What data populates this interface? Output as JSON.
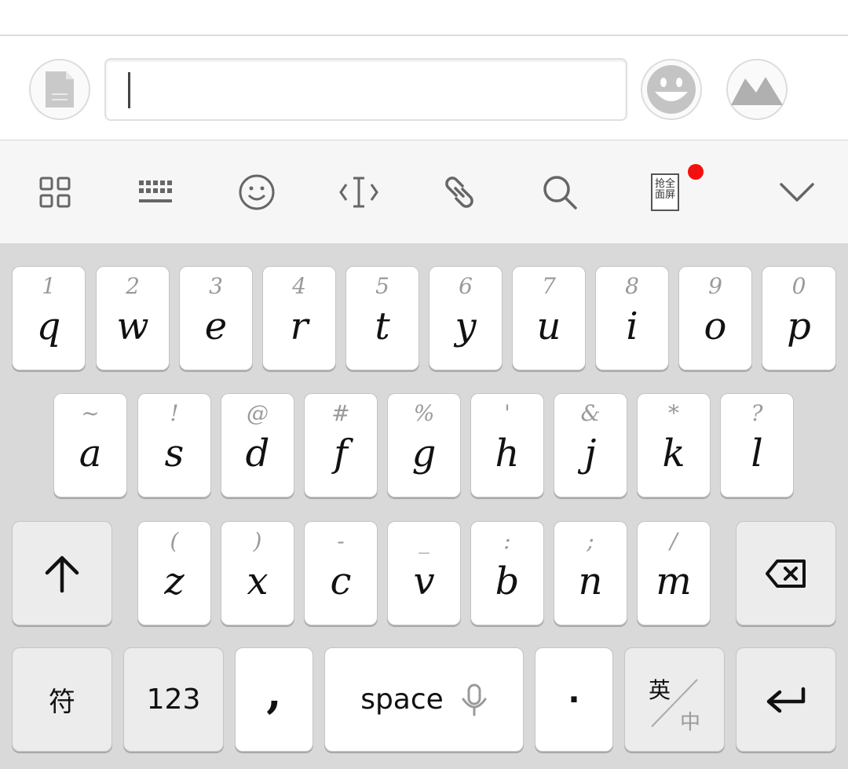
{
  "input_bar": {
    "file_icon": "file-icon",
    "emoji_icon": "emoji-face-icon",
    "image_icon": "mountain-image-icon",
    "text_value": ""
  },
  "toolbar": {
    "items": [
      {
        "icon": "grid-apps-icon"
      },
      {
        "icon": "keyboard-icon"
      },
      {
        "icon": "smiley-icon"
      },
      {
        "icon": "text-cursor-icon"
      },
      {
        "icon": "link-icon"
      },
      {
        "icon": "search-icon"
      },
      {
        "icon": "fullscreen-grab-icon",
        "label_line1": "抢全",
        "label_line2": "面屏"
      },
      {
        "icon": "chevron-down-icon"
      }
    ],
    "notification_color": "#f40f0f"
  },
  "keyboard": {
    "row1": [
      {
        "main": "q",
        "hint": "1"
      },
      {
        "main": "w",
        "hint": "2"
      },
      {
        "main": "e",
        "hint": "3"
      },
      {
        "main": "r",
        "hint": "4"
      },
      {
        "main": "t",
        "hint": "5"
      },
      {
        "main": "y",
        "hint": "6"
      },
      {
        "main": "u",
        "hint": "7"
      },
      {
        "main": "i",
        "hint": "8"
      },
      {
        "main": "o",
        "hint": "9"
      },
      {
        "main": "p",
        "hint": "0"
      }
    ],
    "row2": [
      {
        "main": "a",
        "hint": "~"
      },
      {
        "main": "s",
        "hint": "!"
      },
      {
        "main": "d",
        "hint": "@"
      },
      {
        "main": "f",
        "hint": "#"
      },
      {
        "main": "g",
        "hint": "%"
      },
      {
        "main": "h",
        "hint": "'"
      },
      {
        "main": "j",
        "hint": "&"
      },
      {
        "main": "k",
        "hint": "*"
      },
      {
        "main": "l",
        "hint": "?"
      }
    ],
    "row3": [
      {
        "main": "z",
        "hint": "("
      },
      {
        "main": "x",
        "hint": ")"
      },
      {
        "main": "c",
        "hint": "-"
      },
      {
        "main": "v",
        "hint": "_"
      },
      {
        "main": "b",
        "hint": ":"
      },
      {
        "main": "n",
        "hint": ";"
      },
      {
        "main": "m",
        "hint": "/"
      }
    ],
    "shift_icon": "shift-arrow-up-icon",
    "backspace_icon": "backspace-icon",
    "symbols_label": "符",
    "numbers_label": "123",
    "comma_label": ",",
    "space_label": "space",
    "mic_icon": "microphone-icon",
    "period_label": "·",
    "lang_en": "英",
    "lang_zh": "中",
    "enter_icon": "enter-arrow-icon"
  }
}
